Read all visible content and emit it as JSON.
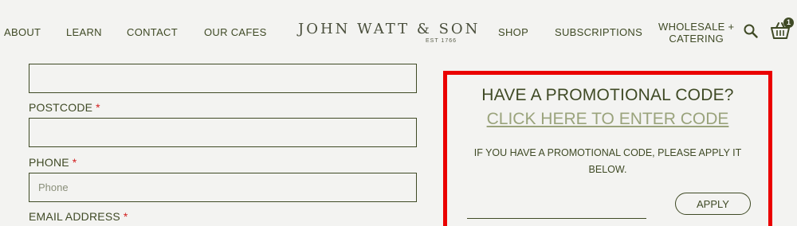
{
  "nav": {
    "left_items": [
      "ABOUT",
      "LEARN",
      "CONTACT",
      "OUR CAFES"
    ],
    "right_items": [
      "SHOP",
      "SUBSCRIPTIONS"
    ],
    "wholesale_line1": "WHOLESALE +",
    "wholesale_line2": "CATERING",
    "logo_name": "JOHN WATT & SON",
    "logo_est": "EST 1766",
    "cart_count": "1"
  },
  "form": {
    "postcode_label": "POSTCODE",
    "phone_label": "PHONE",
    "phone_placeholder": "Phone",
    "email_label": "EMAIL ADDRESS",
    "required_marker": "*"
  },
  "promo": {
    "title": "HAVE A PROMOTIONAL CODE?",
    "link": "CLICK HERE TO ENTER CODE",
    "description": "IF YOU HAVE A PROMOTIONAL CODE, PLEASE APPLY IT BELOW.",
    "apply_label": "APPLY"
  },
  "colors": {
    "text": "#3f4a25",
    "link": "#9aa37c",
    "highlight_border": "#ea0000",
    "required": "#d21f1f",
    "background": "#f3f3f1"
  },
  "icons": [
    "search-icon",
    "basket-icon"
  ]
}
